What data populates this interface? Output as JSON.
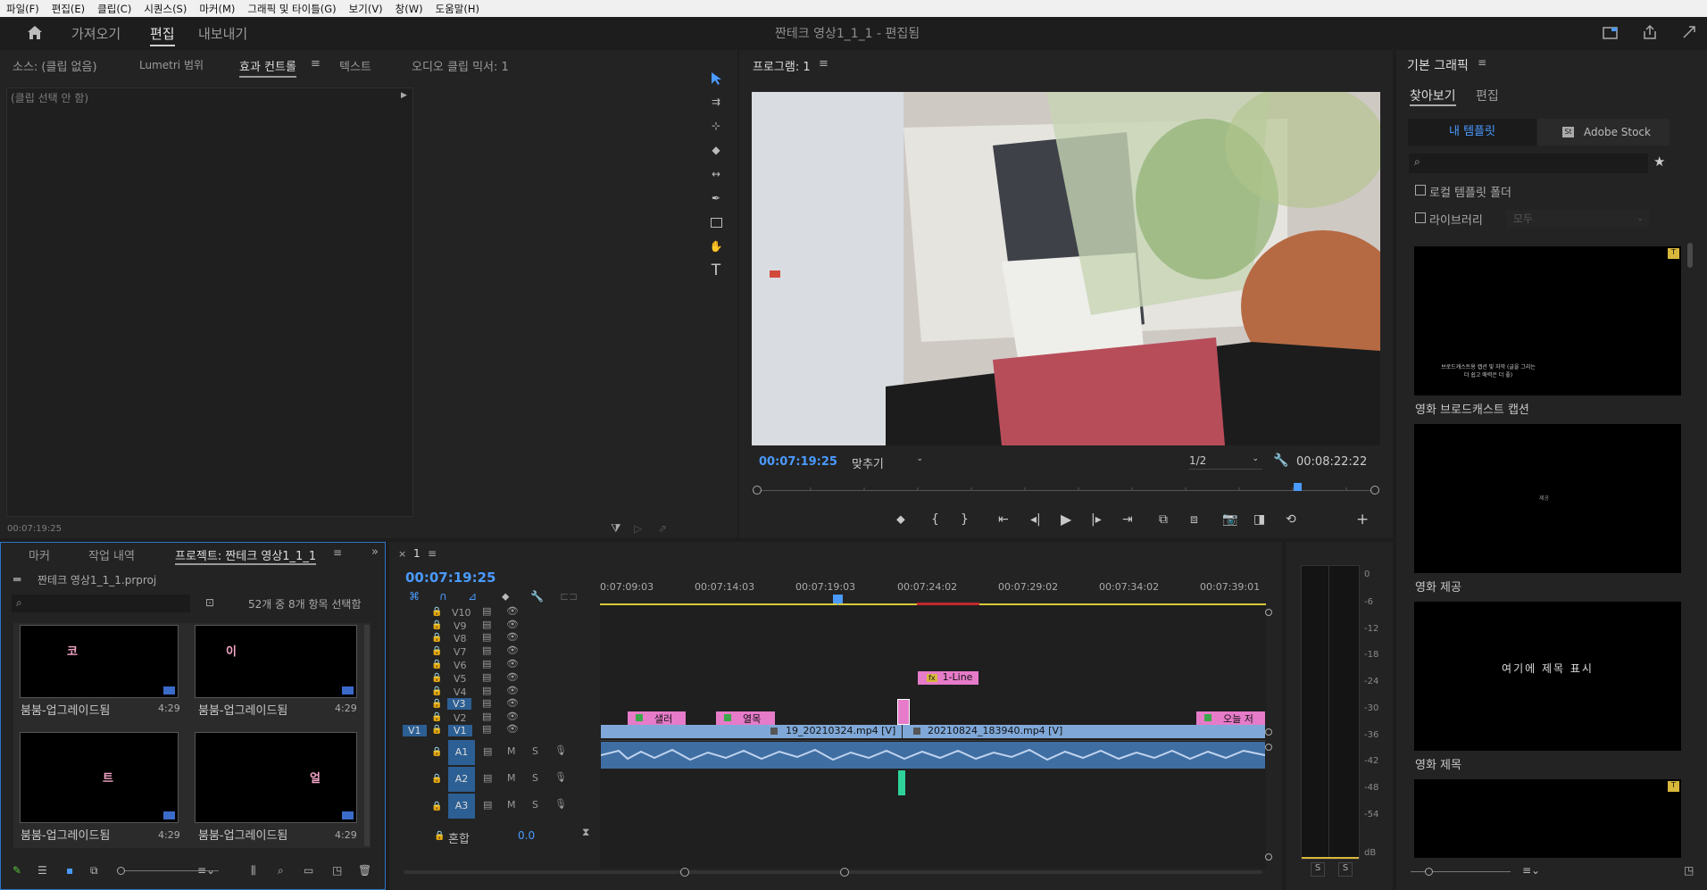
{
  "menu": [
    "파일(F)",
    "편집(E)",
    "클립(C)",
    "시퀀스(S)",
    "마커(M)",
    "그래픽 및 타이틀(G)",
    "보기(V)",
    "창(W)",
    "도움말(H)"
  ],
  "workspace": {
    "tabs": [
      "가져오기",
      "편집",
      "내보내기"
    ],
    "title": "짠테크 영상1_1_1 - 편집됨"
  },
  "source": {
    "tabs": [
      "소스: (클립 없음)",
      "Lumetri 범위",
      "효과 컨트롤",
      "텍스트",
      "오디오 클립 믹서: 1"
    ],
    "no_clip": "(클립 선택 안 함)",
    "timecode": "00:07:19:25"
  },
  "program": {
    "title": "프로그램: 1",
    "timecode": "00:07:19:25",
    "fit": "맞추기",
    "quality": "1/2",
    "duration": "00:08:22:22"
  },
  "project": {
    "tabs": [
      "마커",
      "작업 내역",
      "프로젝트: 짠테크 영상1_1_1"
    ],
    "file": "짠테크 영상1_1_1.prproj",
    "count": "52개 중 8개 항목 선택함",
    "items": [
      {
        "name": "붐붐-업그레이드됨",
        "dur": "4:29",
        "glyph": "코"
      },
      {
        "name": "붐붐-업그레이드됨",
        "dur": "4:29",
        "glyph": "이"
      },
      {
        "name": "붐붐-업그레이드됨",
        "dur": "4:29",
        "glyph": "트"
      },
      {
        "name": "붐붐-업그레이드됨",
        "dur": "4:29",
        "glyph": "얼"
      }
    ]
  },
  "timeline": {
    "tab": "1",
    "timecode": "00:07:19:25",
    "ruler": [
      "0:07:09:03",
      "00:07:14:03",
      "00:07:19:03",
      "00:07:24:02",
      "00:07:29:02",
      "00:07:34:02",
      "00:07:39:01"
    ],
    "video_tracks": [
      "V10",
      "V9",
      "V8",
      "V7",
      "V6",
      "V5",
      "V4",
      "V3",
      "V2",
      "V1"
    ],
    "audio_tracks": [
      "A1",
      "A2",
      "A3"
    ],
    "mix_label": "혼합",
    "mix_value": "0.0",
    "v1_source": "V1",
    "clips": {
      "fx": "1-Line",
      "t1": "샐러",
      "t2": "열목",
      "t3": "오늘 저",
      "v1a": "19_20210324.mp4 [V]",
      "v1b": "20210824_183940.mp4 [V]"
    }
  },
  "meter": {
    "ticks": [
      "0",
      "-6",
      "-12",
      "-18",
      "-24",
      "-30",
      "-36",
      "-42",
      "-48",
      "-54",
      "dB"
    ],
    "solo": [
      "S",
      "S"
    ]
  },
  "graphics": {
    "title": "기본 그래픽",
    "tabs": [
      "찾아보기",
      "편집"
    ],
    "templates_btn": "내 템플릿",
    "stock_btn": "Adobe Stock",
    "local_folder": "로컬 템플릿 폴더",
    "library": "라이브러리",
    "library_value": "모두",
    "templates": [
      {
        "name": "영화 브로드캐스트 캡션",
        "preview": "브로드캐스트용 캡션 및 자막 (글을 그리는 더 쉽고 매력은 더 좋)"
      },
      {
        "name": "영화 제공",
        "preview": "제공"
      },
      {
        "name": "영화 제목",
        "preview": "여기에 제목 표시"
      }
    ]
  }
}
